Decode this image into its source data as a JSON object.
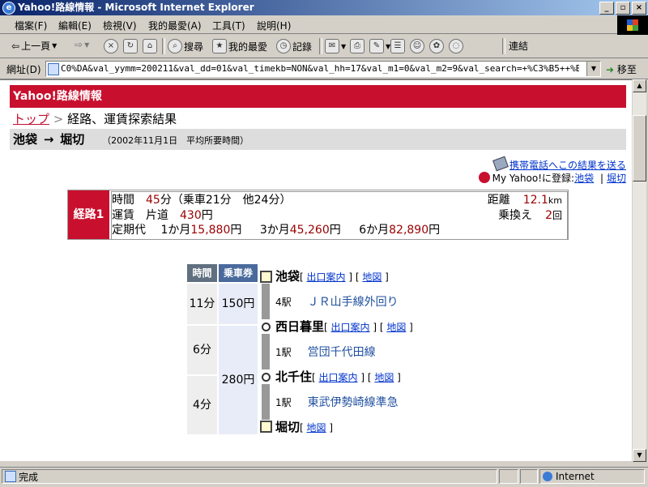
{
  "window": {
    "title": "Yahoo!路線情報 - Microsoft Internet Explorer"
  },
  "menu": [
    "檔案(F)",
    "編輯(E)",
    "檢視(V)",
    "我的最愛(A)",
    "工具(T)",
    "說明(H)"
  ],
  "toolbar": {
    "back": "上一頁",
    "search": "搜尋",
    "favorites": "我的最愛",
    "history": "記錄",
    "links": "連結"
  },
  "address": {
    "label": "網址(D)",
    "url": "C0%DA&val_yymm=200211&val_dd=01&val_timekb=NON&val_hh=17&val_m1=0&val_m2=9&val_search=+%C3%B5++%BA%F7+",
    "go": "移至"
  },
  "page": {
    "header": "Yahoo!路線情報",
    "breadcrumb": {
      "top": "トップ",
      "sep": ">",
      "current": "経路、運賃探索結果"
    },
    "route": {
      "from": "池袋",
      "arrow": "→",
      "to": "堀切",
      "note": "（2002年11月1日　平均所要時間）"
    },
    "send_mobile": "携帯電話へこの結果を送る",
    "myyahoo": {
      "prefix": "My Yahoo!に登録:",
      "link1": "池袋",
      "sep": "|",
      "link2": "堀切"
    },
    "summary": {
      "label": "経路1",
      "time_label": "時間",
      "time_value": "45",
      "time_unit": "分",
      "time_detail": "（乗車21分　他24分）",
      "distance_label": "距離",
      "distance_value": "12.1",
      "distance_unit": "km",
      "fare_label": "運賃　片道",
      "fare_value": "430",
      "fare_unit": "円",
      "transfers_label": "乗換え",
      "transfers_value": "2",
      "transfers_unit": "回",
      "pass_label": "定期代",
      "pass_1m_label": "1か月",
      "pass_1m_value": "15,880",
      "pass_3m_label": "3か月",
      "pass_3m_value": "45,260",
      "pass_6m_label": "6か月",
      "pass_6m_value": "82,890",
      "yen": "円"
    },
    "detail": {
      "header_time": "時間",
      "header_fare": "乗車券",
      "times": [
        "11分",
        "6分",
        "4分"
      ],
      "fares": [
        "150円",
        "280円"
      ],
      "exit_link": "出口案内",
      "map_link": "地図",
      "stations": [
        "池袋",
        "西日暮里",
        "北千住",
        "堀切"
      ],
      "segments": [
        {
          "stops": "4駅",
          "line": "ＪＲ山手線外回り"
        },
        {
          "stops": "1駅",
          "line": "営団千代田線"
        },
        {
          "stops": "1駅",
          "line": "東武伊勢崎線準急"
        }
      ]
    }
  },
  "status": {
    "text": "完成",
    "zone": "Internet"
  }
}
